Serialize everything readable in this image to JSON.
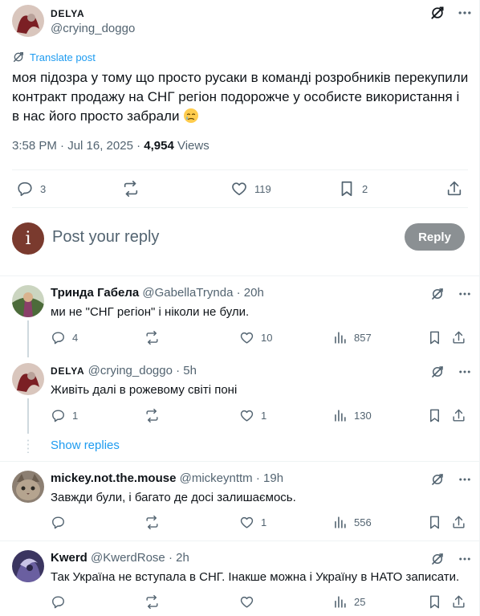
{
  "post": {
    "author_name": "DELYA",
    "author_handle": "@crying_doggo",
    "translate_label": "Translate post",
    "text": "моя підозра у тому що просто русаки в команді розробників перекупили контракт продажу на СНГ регіон подорожче у особисте використання і в нас його просто забрали",
    "emoji_name": "crying-face-emoji",
    "time": "3:58 PM · Jul 16, 2025 · ",
    "views_count": "4,954",
    "views_label": " Views",
    "replies": "3",
    "likes": "119",
    "bookmarks": "2"
  },
  "compose": {
    "avatar_letter": "i",
    "placeholder": "Post your reply",
    "button_label": "Reply"
  },
  "replies": [
    {
      "name": "Тринда Габела",
      "handle": "@GabellaTrynda",
      "time": "· 20h",
      "text": "ми не \"СНГ регіон\" і ніколи не були.",
      "replies": "4",
      "reposts": "",
      "likes": "10",
      "views": "857"
    },
    {
      "name": "DELYA",
      "handle": "@crying_doggo",
      "time": "· 5h",
      "text": "Живіть далі в рожевому світі поні",
      "replies": "1",
      "reposts": "",
      "likes": "1",
      "views": "130"
    },
    {
      "name": "mickey.not.the.mouse",
      "handle": "@mickeynttm",
      "time": "· 19h",
      "text": "Завжди були, і багато де досі залишаємось.",
      "replies": "",
      "reposts": "",
      "likes": "1",
      "views": "556"
    },
    {
      "name": "Kwerd",
      "handle": "@KwerdRose",
      "time": "· 2h",
      "text": "Так Україна не вступала в СНГ. Інакше можна і Україну в НАТО записати.",
      "replies": "",
      "reposts": "",
      "likes": "",
      "views": "25"
    }
  ],
  "show_replies_label": "Show replies",
  "colors": {
    "accent": "#1d9bf0",
    "text": "#0f1419",
    "muted": "#536471",
    "border": "#eff3f4",
    "reply_button": "#8b9093"
  }
}
